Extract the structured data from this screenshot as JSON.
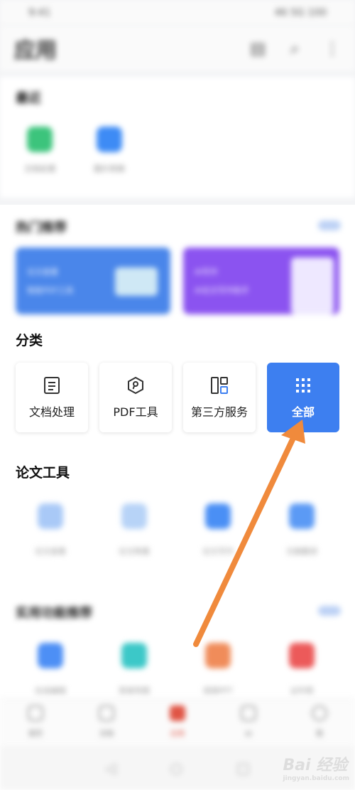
{
  "status_bar": {
    "left": "9:41",
    "right": "46 5G 100"
  },
  "header": {
    "title": "应用"
  },
  "recent": {
    "title": "最近",
    "items": [
      {
        "label": "文档处理",
        "color": "#3cc47c"
      },
      {
        "label": "图片转换",
        "color": "#3d8bf5"
      }
    ]
  },
  "hot": {
    "title": "热门推荐",
    "more": "更多"
  },
  "banners": [
    {
      "text_1": "论文查重",
      "text_2": "智能PDF工具",
      "color": "#4a86ea"
    },
    {
      "text_1": "AI写作",
      "text_2": "AI论文写作助手",
      "color": "#8b53f0"
    }
  ],
  "categories": {
    "title": "分类",
    "items": [
      {
        "label": "文档处理",
        "icon": "document-icon"
      },
      {
        "label": "PDF工具",
        "icon": "pdf-icon"
      },
      {
        "label": "第三方服务",
        "icon": "layout-icon"
      },
      {
        "label": "全部",
        "icon": "grid-icon",
        "active": true
      }
    ]
  },
  "thesis": {
    "title": "论文工具",
    "items": [
      {
        "label": "论文查重",
        "color": "#a9c9f7"
      },
      {
        "label": "论文降重",
        "color": "#b7d3f7"
      },
      {
        "label": "论文写作",
        "color": "#4a8ff5"
      },
      {
        "label": "文献翻译",
        "color": "#5b9af5"
      }
    ]
  },
  "recommend": {
    "title": "实用功能推荐",
    "more": "更多",
    "items": [
      {
        "label": "在线编辑",
        "color": "#4d8ff5"
      },
      {
        "label": "思维导图",
        "color": "#3cc8c8"
      },
      {
        "label": "视频PPT",
        "color": "#f08c5a"
      },
      {
        "label": "证件照",
        "color": "#ec5a5a"
      }
    ]
  },
  "bottom_nav": [
    {
      "label": "首页"
    },
    {
      "label": "文档"
    },
    {
      "label": "应用"
    },
    {
      "label": "AI"
    },
    {
      "label": "我"
    }
  ],
  "watermark": {
    "brand": "Bai 经验",
    "url": "jingyan.baidu.com"
  },
  "arrow_color": "#f08a3c"
}
